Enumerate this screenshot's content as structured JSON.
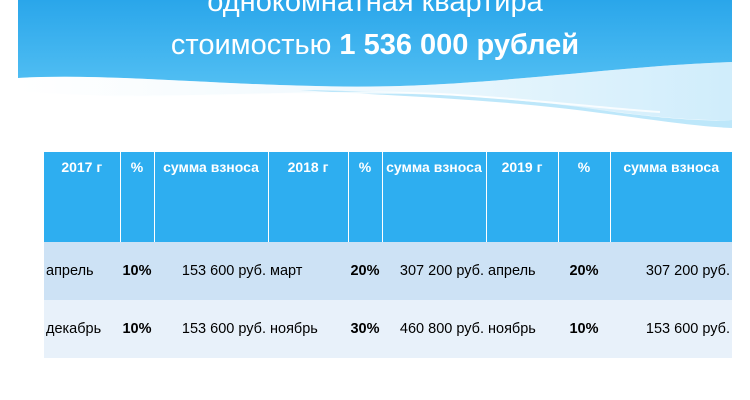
{
  "header": {
    "title_line1": "однокомнатная квартира",
    "title_line2_prefix": "стоимостью",
    "title_line2_price": "1 536 000 рублей",
    "colors": {
      "primary": "#2eaef0",
      "wave": "#5ec3f3"
    }
  },
  "table": {
    "columns": [
      "2017 г",
      "%",
      "сумма взноса",
      "2018 г",
      "%",
      "сумма взноса",
      "2019 г",
      "%",
      "сумма взноса"
    ],
    "rows": [
      [
        "апрель",
        "10%",
        "153 600 руб.",
        "март",
        "20%",
        "307 200 руб.",
        "апрель",
        "20%",
        "307 200 руб."
      ],
      [
        "декабрь",
        "10%",
        "153 600 руб.",
        "ноябрь",
        "30%",
        "460 800 руб.",
        "ноябрь",
        "10%",
        "153 600 руб."
      ]
    ],
    "colors": {
      "header_bg": "#2eaef0",
      "row1_bg": "#cde2f5",
      "row2_bg": "#e8f1fa"
    }
  }
}
